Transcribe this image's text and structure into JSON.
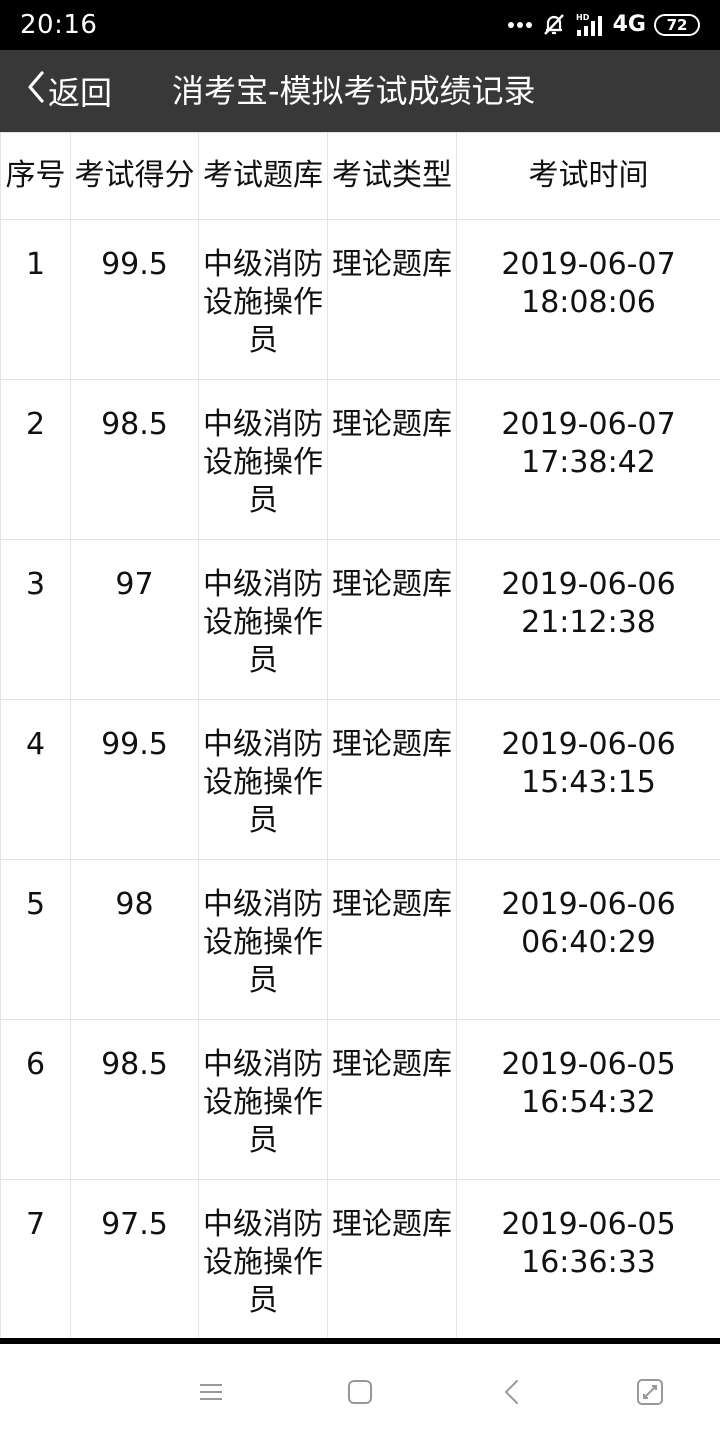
{
  "status_bar": {
    "time": "20:16",
    "network": "4G",
    "battery": "72",
    "icons": [
      "dots-icon",
      "mute-icon",
      "hd-signal-icon",
      "battery-icon"
    ]
  },
  "header": {
    "back_label": "返回",
    "title": "消考宝-模拟考试成绩记录"
  },
  "table": {
    "columns": [
      "序号",
      "考试得分",
      "考试题库",
      "考试类型",
      "考试时间"
    ],
    "rows": [
      {
        "index": "1",
        "score": "99.5",
        "bank": "中级消防设施操作员",
        "type": "理论题库",
        "date": "2019-06-07",
        "time": "18:08:06"
      },
      {
        "index": "2",
        "score": "98.5",
        "bank": "中级消防设施操作员",
        "type": "理论题库",
        "date": "2019-06-07",
        "time": "17:38:42"
      },
      {
        "index": "3",
        "score": "97",
        "bank": "中级消防设施操作员",
        "type": "理论题库",
        "date": "2019-06-06",
        "time": "21:12:38"
      },
      {
        "index": "4",
        "score": "99.5",
        "bank": "中级消防设施操作员",
        "type": "理论题库",
        "date": "2019-06-06",
        "time": "15:43:15"
      },
      {
        "index": "5",
        "score": "98",
        "bank": "中级消防设施操作员",
        "type": "理论题库",
        "date": "2019-06-06",
        "time": "06:40:29"
      },
      {
        "index": "6",
        "score": "98.5",
        "bank": "中级消防设施操作员",
        "type": "理论题库",
        "date": "2019-06-05",
        "time": "16:54:32"
      },
      {
        "index": "7",
        "score": "97.5",
        "bank": "中级消防设施操作员",
        "type": "理论题库",
        "date": "2019-06-05",
        "time": "16:36:33"
      }
    ]
  },
  "nav_bar": {
    "icons": [
      "menu-icon",
      "home-icon",
      "back-icon",
      "screenshot-icon"
    ]
  },
  "colors": {
    "status_bar_bg": "#000000",
    "header_bg": "#383838",
    "grid_line": "#e4e4e4"
  }
}
